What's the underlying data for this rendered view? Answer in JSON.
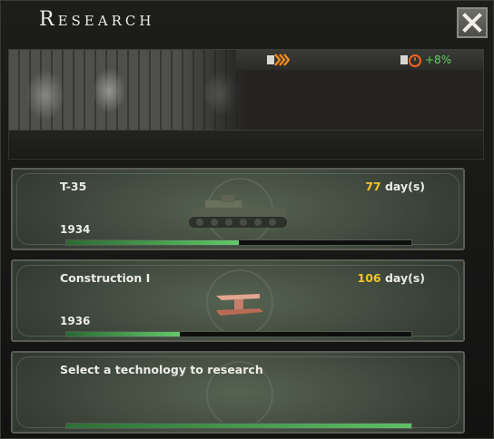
{
  "window": {
    "title": "Research"
  },
  "header": {
    "bonus_percent": "+8%"
  },
  "slots": [
    {
      "name": "T-35",
      "days": "77",
      "days_unit": "day(s)",
      "year": "1934",
      "progress": 0.5,
      "icon": "tank-icon"
    },
    {
      "name": "Construction I",
      "days": "106",
      "days_unit": "day(s)",
      "year": "1936",
      "progress": 0.33,
      "icon": "steel-beam-icon"
    }
  ],
  "empty_slot": {
    "label": "Select a technology to research"
  },
  "colors": {
    "days_number": "#f3c32c",
    "bonus": "#5fd35b",
    "progress": "#64c86b"
  }
}
